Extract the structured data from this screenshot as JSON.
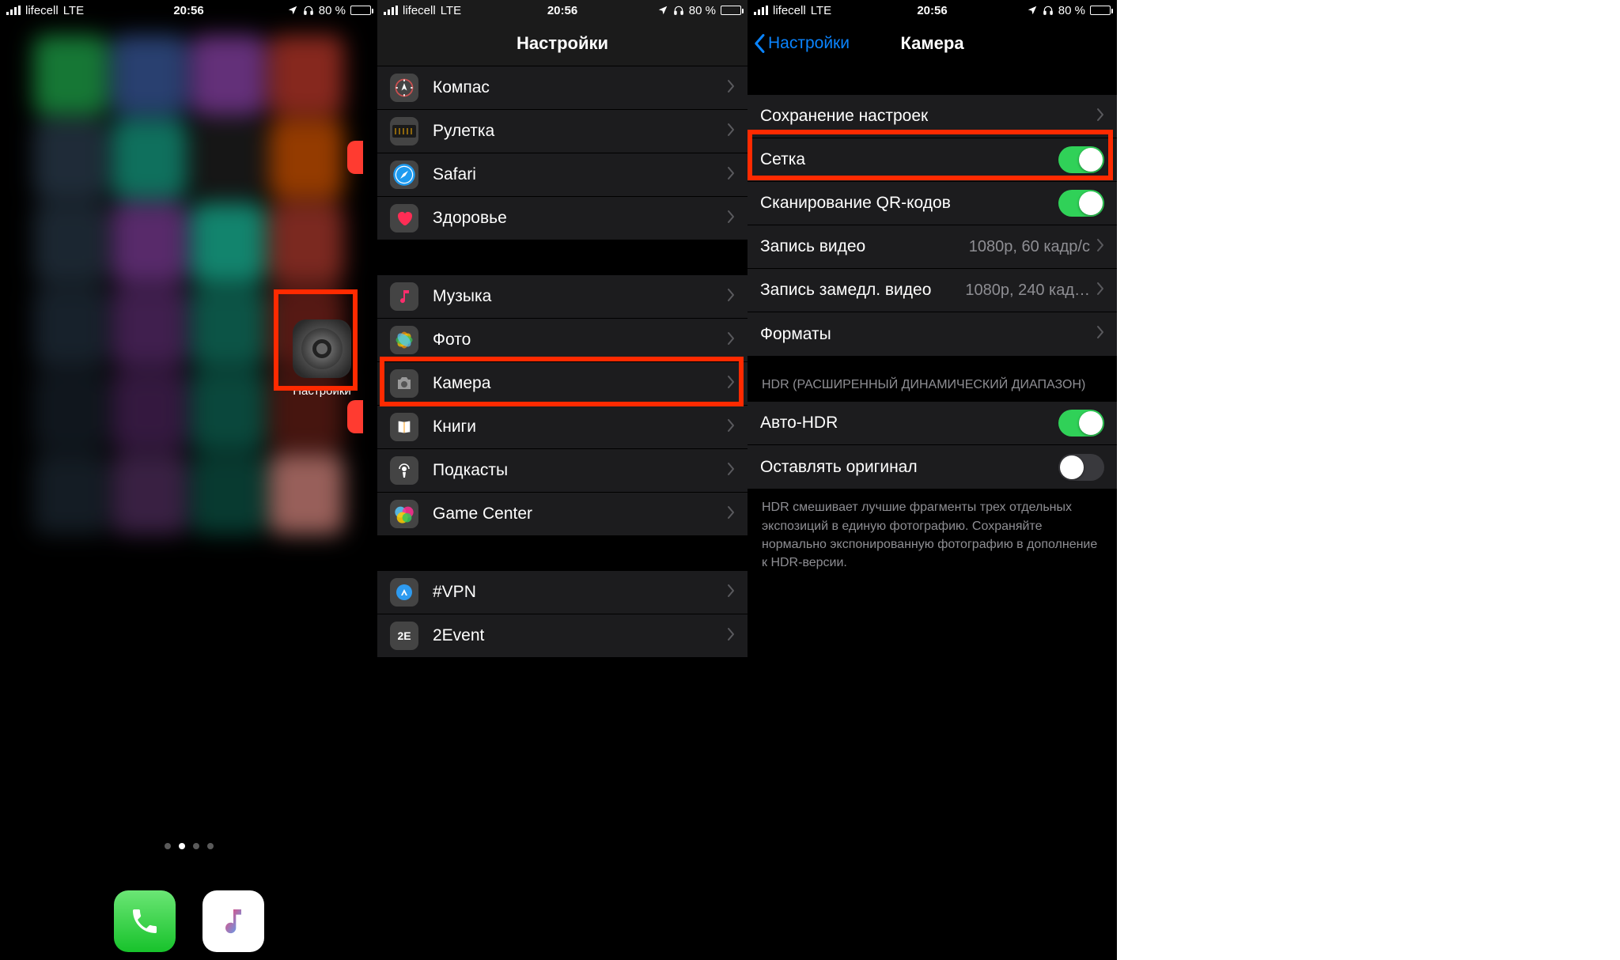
{
  "status": {
    "carrier": "lifecell",
    "network": "LTE",
    "time": "20:56",
    "battery_pct": "80 %"
  },
  "panel1": {
    "settings_label": "Настройки",
    "dock": [
      "phone",
      "music"
    ]
  },
  "panel2": {
    "title": "Настройки",
    "groups": [
      {
        "items": [
          {
            "icon": "compass",
            "label": "Компас"
          },
          {
            "icon": "measure",
            "label": "Рулетка"
          },
          {
            "icon": "safari",
            "label": "Safari"
          },
          {
            "icon": "health",
            "label": "Здоровье"
          }
        ]
      },
      {
        "items": [
          {
            "icon": "music",
            "label": "Музыка"
          },
          {
            "icon": "photos",
            "label": "Фото"
          },
          {
            "icon": "camera",
            "label": "Камера",
            "highlight": true
          },
          {
            "icon": "books",
            "label": "Книги"
          },
          {
            "icon": "podcasts",
            "label": "Подкасты"
          },
          {
            "icon": "gamecenter",
            "label": "Game Center"
          }
        ]
      },
      {
        "items": [
          {
            "icon": "vpn",
            "label": "#VPN"
          },
          {
            "icon": "2event",
            "label": "2Event"
          }
        ]
      }
    ]
  },
  "panel3": {
    "back": "Настройки",
    "title": "Камера",
    "rows_group1": [
      {
        "label": "Сохранение настроек",
        "type": "link"
      },
      {
        "label": "Сетка",
        "type": "toggle",
        "on": true,
        "highlight": true
      },
      {
        "label": "Сканирование QR-кодов",
        "type": "toggle",
        "on": true
      },
      {
        "label": "Запись видео",
        "type": "link",
        "value": "1080p, 60 кадр/с"
      },
      {
        "label": "Запись замедл. видео",
        "type": "link",
        "value": "1080p, 240 кад…"
      },
      {
        "label": "Форматы",
        "type": "link"
      }
    ],
    "hdr_header": "HDR (РАСШИРЕННЫЙ ДИНАМИЧЕСКИЙ ДИАПАЗОН)",
    "rows_group2": [
      {
        "label": "Авто-HDR",
        "type": "toggle",
        "on": true
      },
      {
        "label": "Оставлять оригинал",
        "type": "toggle",
        "on": false
      }
    ],
    "hdr_footer": "HDR смешивает лучшие фрагменты трех отдельных экспозиций в единую фотографию. Сохраняйте нормально экспонированную фотографию в дополнение к HDR-версии."
  }
}
